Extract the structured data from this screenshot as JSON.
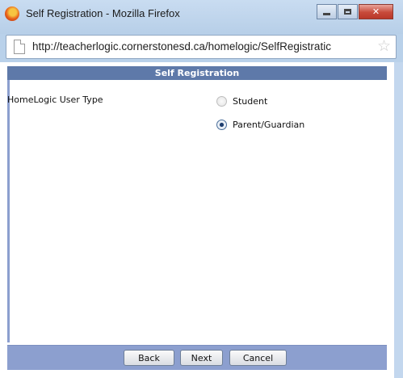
{
  "window": {
    "title": "Self Registration - Mozilla Firefox",
    "controls": {
      "minimize": "",
      "maximize": "",
      "close": "✕"
    }
  },
  "browser": {
    "url": "http://teacherlogic.cornerstonesd.ca/homelogic/SelfRegistratic",
    "star_glyph": "☆"
  },
  "form": {
    "header": "Self Registration",
    "field_label": "HomeLogic User Type",
    "options": [
      {
        "label": "Student",
        "checked": false
      },
      {
        "label": "Parent/Guardian",
        "checked": true
      }
    ]
  },
  "footer": {
    "back_label": "Back",
    "next_label": "Next",
    "cancel_label": "Cancel"
  },
  "colors": {
    "header_bg": "#5e79a9",
    "footer_bg": "#8c9fcf",
    "window_frame": "#b9d1ea"
  }
}
